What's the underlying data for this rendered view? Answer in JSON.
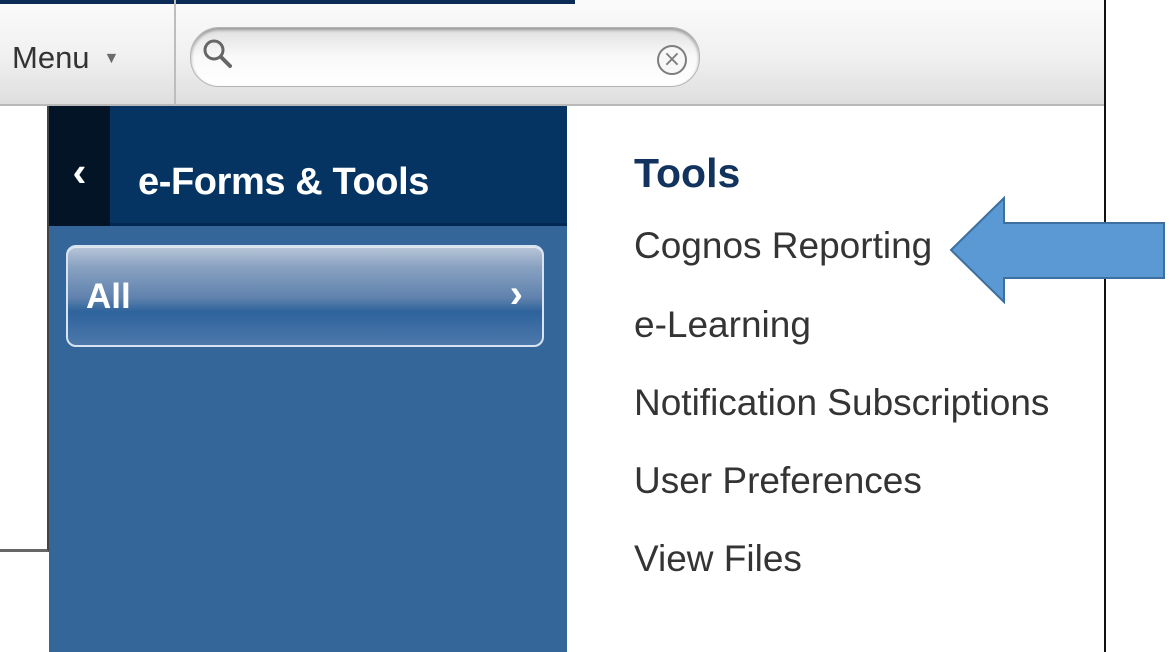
{
  "toolbar": {
    "menu_label": "Menu",
    "menu_caret": "▼",
    "search": {
      "value": "",
      "placeholder": "",
      "search_icon": "search-icon",
      "clear_icon": "clear-icon",
      "clear_glyph": "×"
    }
  },
  "navigation": {
    "back_icon": "chevron-left-icon",
    "back_glyph": "‹",
    "title": "e-Forms & Tools",
    "all_item": {
      "label": "All",
      "chevron_icon": "chevron-right-icon",
      "chevron_glyph": "›"
    }
  },
  "tools": {
    "heading": "Tools",
    "items": [
      "Cognos Reporting",
      "e-Learning",
      "Notification Subscriptions",
      "User Preferences",
      "View Files"
    ]
  },
  "colors": {
    "navy_header": "#053463",
    "nav_panel": "#34669a",
    "heading_text": "#12335d",
    "annotation_arrow": "#5b99d4",
    "annotation_arrow_outline": "#3d6f9f"
  },
  "annotation": {
    "arrow_icon": "left-arrow-icon"
  }
}
